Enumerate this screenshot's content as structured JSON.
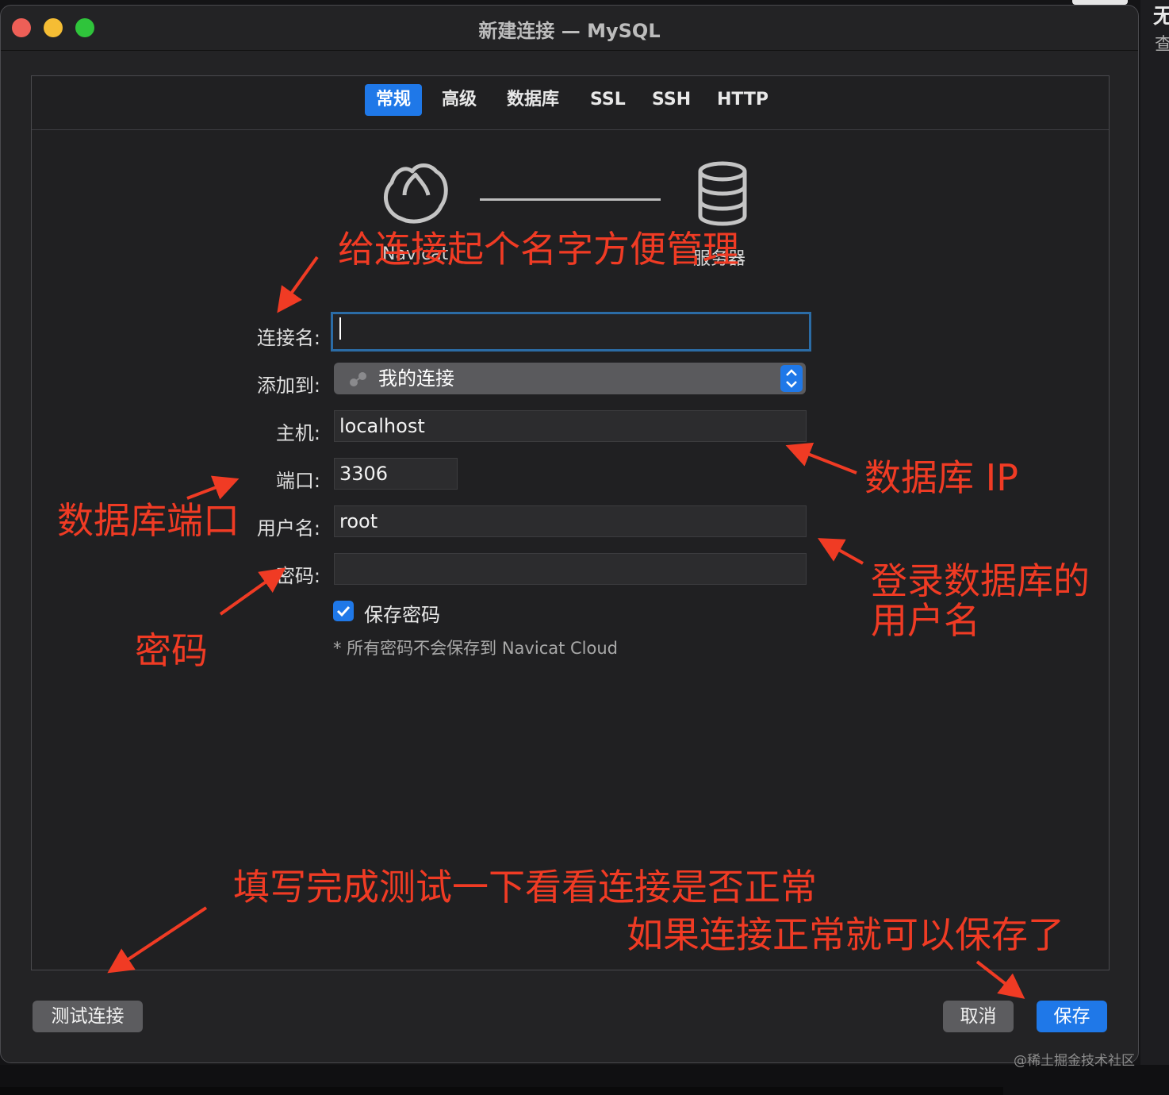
{
  "window": {
    "title": "新建连接 — MySQL"
  },
  "traffic_lights": {
    "close_color": "#ee5f57",
    "minimize_color": "#f5bd34",
    "zoom_color": "#2fc43b"
  },
  "tabs": [
    {
      "label": "常规",
      "active": true
    },
    {
      "label": "高级",
      "active": false
    },
    {
      "label": "数据库",
      "active": false
    },
    {
      "label": "SSL",
      "active": false
    },
    {
      "label": "SSH",
      "active": false
    },
    {
      "label": "HTTP",
      "active": false
    }
  ],
  "diagram": {
    "left_label": "Navicat",
    "right_label": "服务器",
    "left_icon": "navicat-icon",
    "right_icon": "database-icon"
  },
  "form": {
    "connection_name": {
      "label": "连接名:",
      "value": ""
    },
    "add_to": {
      "label": "添加到:",
      "value": "我的连接",
      "icon": "group-icon"
    },
    "host": {
      "label": "主机:",
      "value": "localhost"
    },
    "port": {
      "label": "端口:",
      "value": "3306"
    },
    "username": {
      "label": "用户名:",
      "value": "root"
    },
    "password": {
      "label": "密码:",
      "value": ""
    },
    "save_password": {
      "label": "保存密码",
      "checked": true
    },
    "note": "* 所有密码不会保存到 Navicat Cloud"
  },
  "buttons": {
    "test": "测试连接",
    "cancel": "取消",
    "save": "保存"
  },
  "annotations": {
    "name": "给连接起个名字方便管理",
    "ip": "数据库 IP",
    "port": "数据库端口",
    "user_line1": "登录数据库的",
    "user_line2": "用户名",
    "password": "密码",
    "test_line1": "填写完成测试一下看看连接是否正常",
    "test_line2": "如果连接正常就可以保存了"
  },
  "background": {
    "right_glyph_1": "无",
    "right_glyph_2": "查"
  },
  "watermark": "@稀土掘金技术社区",
  "colors": {
    "accent": "#1f78e8",
    "annotation": "#f03b24",
    "window_bg": "#232325"
  }
}
